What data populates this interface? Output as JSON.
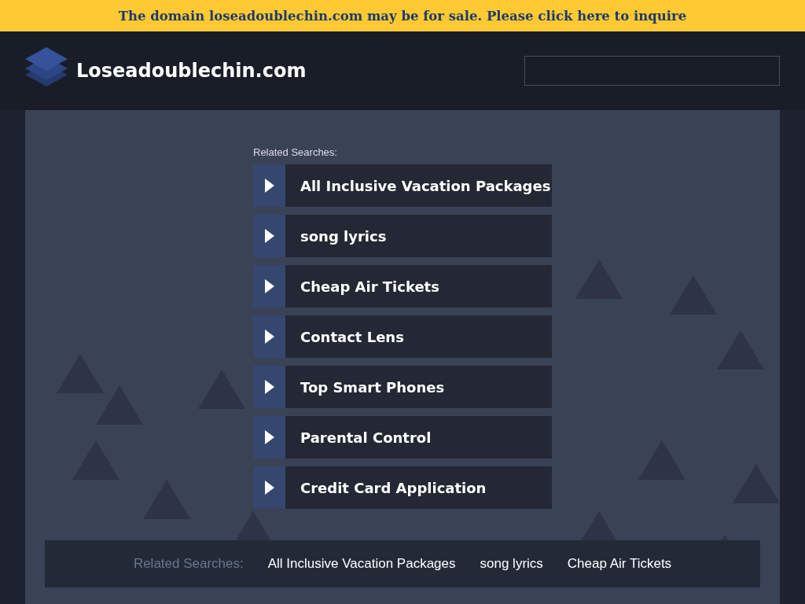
{
  "banner": {
    "text": "The domain loseadoublechin.com may be for sale. Please click here to inquire"
  },
  "header": {
    "site_name": "Loseadoublechin.com"
  },
  "related": {
    "label": "Related Searches:",
    "links": [
      {
        "label": "All Inclusive Vacation Packages"
      },
      {
        "label": "song lyrics"
      },
      {
        "label": "Cheap Air Tickets"
      },
      {
        "label": "Contact Lens"
      },
      {
        "label": "Top Smart Phones"
      },
      {
        "label": "Parental Control"
      },
      {
        "label": "Credit Card Application"
      }
    ]
  },
  "footer": {
    "label": "Related Searches:",
    "links": [
      {
        "label": "All Inclusive Vacation Packages"
      },
      {
        "label": "song lyrics"
      },
      {
        "label": "Cheap Air Tickets"
      }
    ]
  }
}
